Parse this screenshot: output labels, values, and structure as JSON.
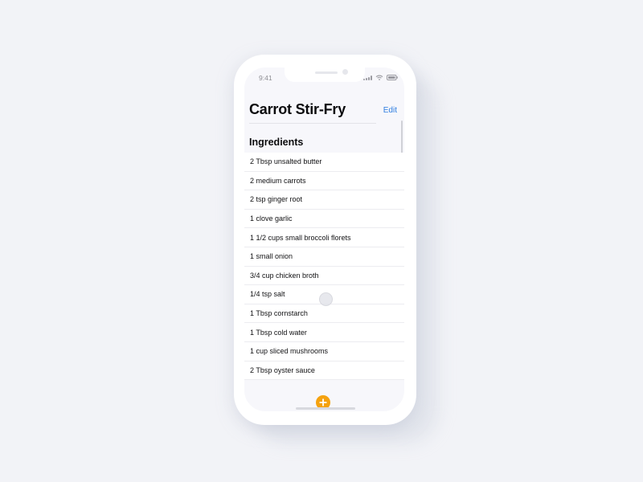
{
  "status_bar": {
    "time": "9:41",
    "icons": [
      "signal-icon",
      "wifi-icon",
      "battery-icon"
    ]
  },
  "header": {
    "title": "Carrot Stir-Fry",
    "edit_label": "Edit"
  },
  "section": {
    "title": "Ingredients"
  },
  "ingredients": [
    "2 Tbsp unsalted butter",
    "2 medium carrots",
    "2 tsp ginger root",
    "1 clove garlic",
    "1 1/2 cups small broccoli florets",
    "1 small onion",
    "3/4 cup chicken broth",
    "1/4 tsp salt",
    "1 Tbsp cornstarch",
    "1 Tbsp cold water",
    "1 cup sliced mushrooms",
    "2 Tbsp oyster sauce"
  ],
  "footer": {
    "add_icon": "plus-circle-icon"
  },
  "colors": {
    "accent_link": "#2f7ee0",
    "add_button": "#f5a20f",
    "background": "#f2f3f7"
  }
}
